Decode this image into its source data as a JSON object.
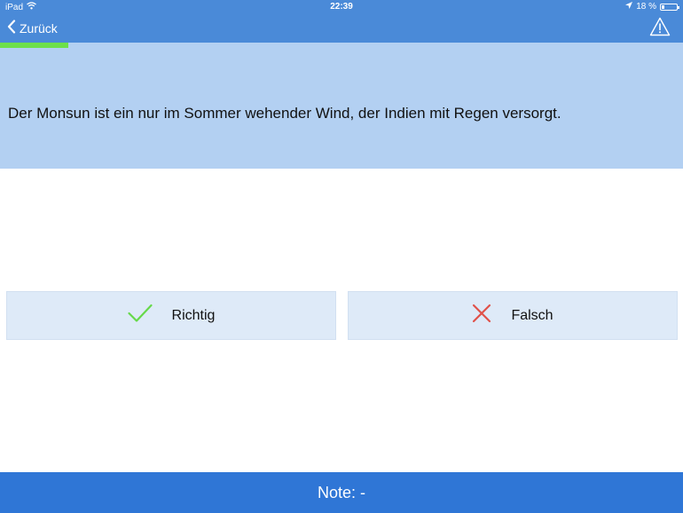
{
  "status_bar": {
    "device": "iPad",
    "time": "22:39",
    "battery_text": "18 %",
    "battery_level": 0.18,
    "icons": [
      "wifi-icon",
      "location-arrow-icon",
      "battery-icon"
    ]
  },
  "nav": {
    "back_label": "Zurück",
    "back_icon": "chevron-left-icon",
    "warning_icon": "warning-triangle-icon"
  },
  "progress": {
    "fraction": 0.1
  },
  "question": {
    "text": "Der Monsun ist ein nur im Sommer wehender Wind, der Indien mit Regen versorgt."
  },
  "answers": {
    "true_label": "Richtig",
    "true_icon": "checkmark-icon",
    "false_label": "Falsch",
    "false_icon": "cross-icon"
  },
  "footer": {
    "grade_text": "Note: -"
  },
  "colors": {
    "nav_blue": "#4a8ad8",
    "question_bg": "#b3d0f2",
    "answer_bg": "#deeaf8",
    "footer_blue": "#2f76d6",
    "progress_green": "#6de04a",
    "check_green": "#66d94a",
    "cross_red": "#e0524a"
  }
}
